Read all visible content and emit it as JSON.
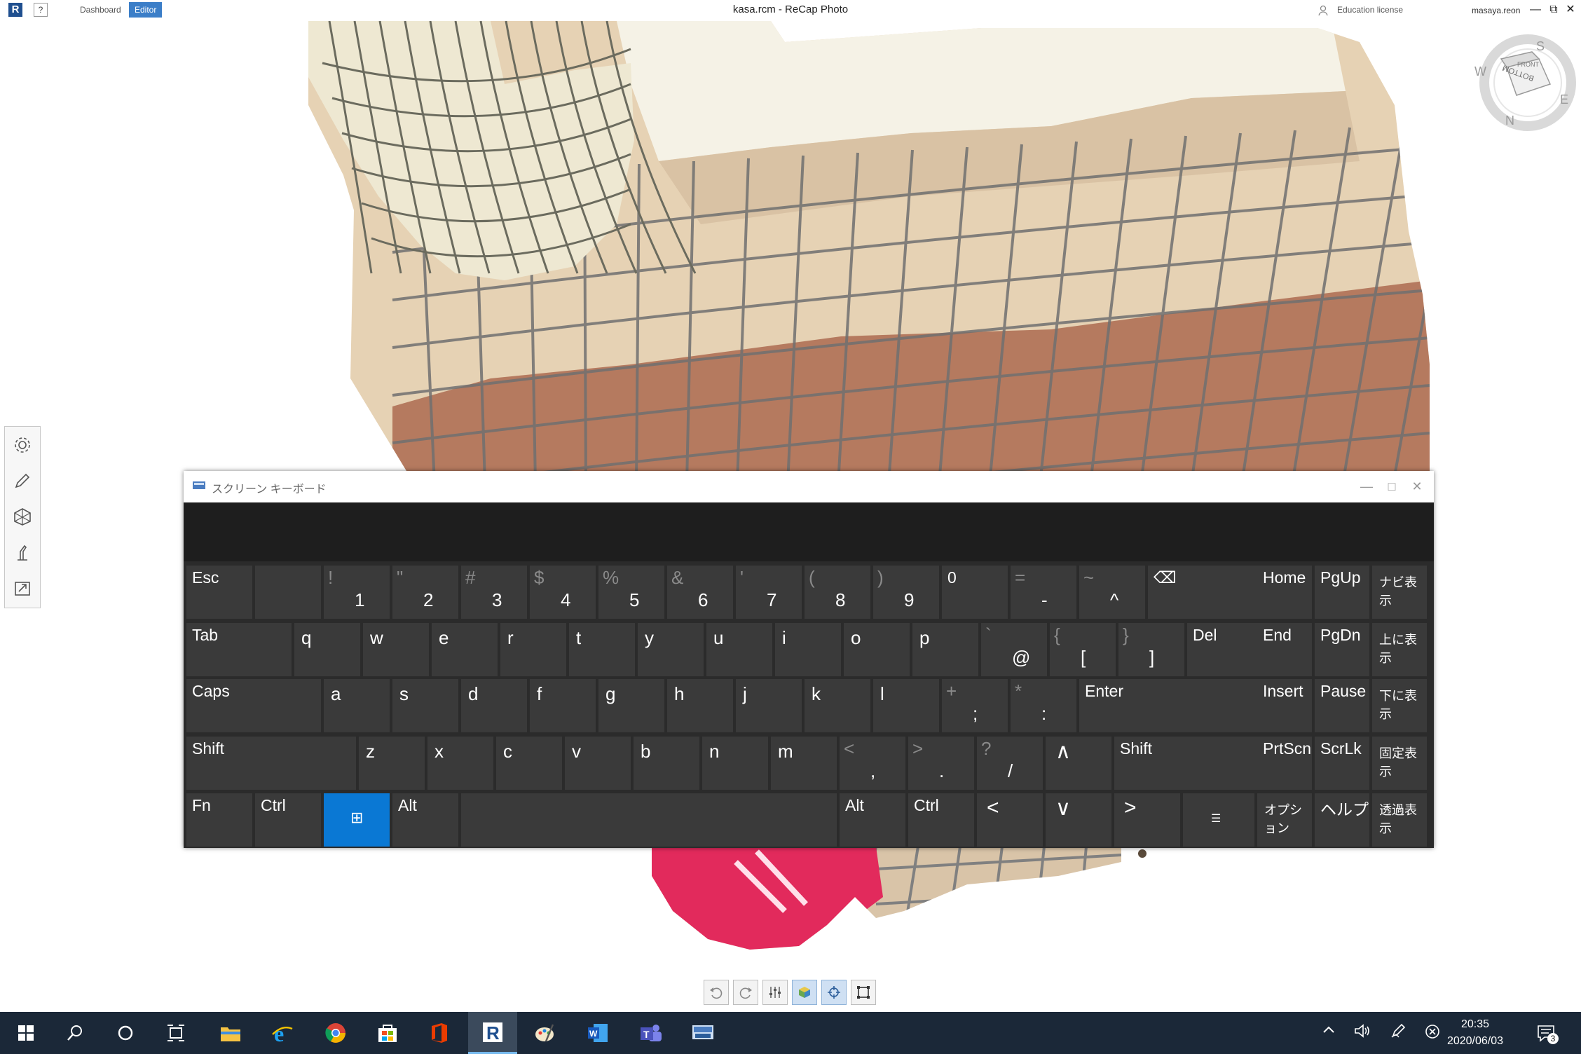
{
  "app": {
    "title": "kasa.rcm - ReCap Photo",
    "logo": "R",
    "help": "?",
    "tabs": [
      {
        "label": "Dashboard",
        "active": false
      },
      {
        "label": "Editor",
        "active": true
      }
    ],
    "license": "Education license",
    "user": "masaya.reon",
    "window_controls": {
      "minimize": "—",
      "restore": "⧉",
      "close": "✕"
    },
    "viewcube_labels": [
      "S",
      "W",
      "E",
      "N",
      "FRONT",
      "BOTTOM"
    ]
  },
  "left_tools": [
    {
      "name": "settings",
      "icon": "gear-icon"
    },
    {
      "name": "edit",
      "icon": "pencil-icon"
    },
    {
      "name": "mesh",
      "icon": "mesh-icon"
    },
    {
      "name": "measure",
      "icon": "measure-icon"
    },
    {
      "name": "export",
      "icon": "export-icon"
    }
  ],
  "keyboard": {
    "title": "スクリーン キーボード",
    "window_buttons": {
      "minimize": "—",
      "maximize": "□",
      "close": "✕"
    },
    "rows": [
      [
        {
          "l": "Esc",
          "t": "lab",
          "w": 94
        },
        {
          "l": "",
          "t": "lab",
          "w": 94
        },
        {
          "s": "!",
          "m": "1",
          "t": "char",
          "w": 94
        },
        {
          "s": "\"",
          "m": "2",
          "t": "char",
          "w": 94
        },
        {
          "s": "#",
          "m": "3",
          "t": "char",
          "w": 94
        },
        {
          "s": "$",
          "m": "4",
          "t": "char",
          "w": 94
        },
        {
          "s": "%",
          "m": "5",
          "t": "char",
          "w": 94
        },
        {
          "s": "&",
          "m": "6",
          "t": "char",
          "w": 94
        },
        {
          "s": "'",
          "m": "7",
          "t": "char",
          "w": 94
        },
        {
          "s": "(",
          "m": "8",
          "t": "char",
          "w": 94
        },
        {
          "s": ")",
          "m": "9",
          "t": "char",
          "w": 94
        },
        {
          "l": "0",
          "t": "lab",
          "w": 94
        },
        {
          "s": "=",
          "m": "-",
          "t": "char",
          "w": 94
        },
        {
          "s": "~",
          "m": "^",
          "t": "char",
          "w": 94
        },
        {
          "l": "⌫",
          "t": "lab",
          "w": 158
        }
      ],
      [
        {
          "l": "Tab",
          "t": "lab",
          "w": 150
        },
        {
          "l": "q",
          "t": "letter",
          "w": 94
        },
        {
          "l": "w",
          "t": "letter",
          "w": 94
        },
        {
          "l": "e",
          "t": "letter",
          "w": 94
        },
        {
          "l": "r",
          "t": "letter",
          "w": 94
        },
        {
          "l": "t",
          "t": "letter",
          "w": 94
        },
        {
          "l": "y",
          "t": "letter",
          "w": 94
        },
        {
          "l": "u",
          "t": "letter",
          "w": 94
        },
        {
          "l": "i",
          "t": "letter",
          "w": 94
        },
        {
          "l": "o",
          "t": "letter",
          "w": 94
        },
        {
          "l": "p",
          "t": "letter",
          "w": 94
        },
        {
          "s": "`",
          "m": "@",
          "t": "char",
          "w": 94
        },
        {
          "s": "{",
          "m": "[",
          "t": "char",
          "w": 94
        },
        {
          "s": "}",
          "m": "]",
          "t": "char",
          "w": 94
        },
        {
          "l": "Del",
          "t": "lab",
          "w": 102
        }
      ],
      [
        {
          "l": "Caps",
          "t": "lab",
          "w": 192
        },
        {
          "l": "a",
          "t": "letter",
          "w": 94
        },
        {
          "l": "s",
          "t": "letter",
          "w": 94
        },
        {
          "l": "d",
          "t": "letter",
          "w": 94
        },
        {
          "l": "f",
          "t": "letter",
          "w": 94
        },
        {
          "l": "g",
          "t": "letter",
          "w": 94
        },
        {
          "l": "h",
          "t": "letter",
          "w": 94
        },
        {
          "l": "j",
          "t": "letter",
          "w": 94
        },
        {
          "l": "k",
          "t": "letter",
          "w": 94
        },
        {
          "l": "l",
          "t": "letter",
          "w": 94
        },
        {
          "s": "+",
          "m": ";",
          "t": "char",
          "w": 94
        },
        {
          "s": "*",
          "m": ":",
          "t": "char",
          "w": 94
        },
        {
          "l": "Enter",
          "t": "lab",
          "w": 254
        }
      ],
      [
        {
          "l": "Shift",
          "t": "lab",
          "w": 242
        },
        {
          "l": "z",
          "t": "letter",
          "w": 94
        },
        {
          "l": "x",
          "t": "letter",
          "w": 94
        },
        {
          "l": "c",
          "t": "letter",
          "w": 94
        },
        {
          "l": "v",
          "t": "letter",
          "w": 94
        },
        {
          "l": "b",
          "t": "letter",
          "w": 94
        },
        {
          "l": "n",
          "t": "letter",
          "w": 94
        },
        {
          "l": "m",
          "t": "letter",
          "w": 94
        },
        {
          "s": "<",
          "m": ",",
          "t": "char",
          "w": 94
        },
        {
          "s": ">",
          "m": ".",
          "t": "char",
          "w": 94
        },
        {
          "s": "?",
          "m": "/",
          "t": "char",
          "w": 94
        },
        {
          "l": "∧",
          "t": "arrow",
          "w": 94
        },
        {
          "l": "Shift",
          "t": "lab",
          "w": 204
        }
      ],
      [
        {
          "l": "Fn",
          "t": "lab",
          "w": 94
        },
        {
          "l": "Ctrl",
          "t": "lab",
          "w": 94
        },
        {
          "l": "⊞",
          "t": "win",
          "w": 94
        },
        {
          "l": "Alt",
          "t": "lab",
          "w": 94
        },
        {
          "l": "",
          "t": "lab",
          "w": 536
        },
        {
          "l": "Alt",
          "t": "lab",
          "w": 94
        },
        {
          "l": "Ctrl",
          "t": "lab",
          "w": 94
        },
        {
          "l": "<",
          "t": "arrow",
          "w": 94
        },
        {
          "l": "∨",
          "t": "arrow",
          "w": 94
        },
        {
          "l": ">",
          "t": "arrow",
          "w": 94
        },
        {
          "l": "☰",
          "t": "small",
          "w": 102
        }
      ]
    ],
    "nav_keys": [
      [
        {
          "l": "Home"
        },
        {
          "l": "PgUp"
        },
        {
          "l": "ナビ表示",
          "jp": true
        }
      ],
      [
        {
          "l": "End"
        },
        {
          "l": "PgDn"
        },
        {
          "l": "上に表示",
          "jp": true
        }
      ],
      [
        {
          "l": "Insert"
        },
        {
          "l": "Pause"
        },
        {
          "l": "下に表示",
          "jp": true
        }
      ],
      [
        {
          "l": "PrtScn"
        },
        {
          "l": "ScrLk"
        },
        {
          "l": "固定表示",
          "jp": true
        }
      ],
      [
        {
          "l": "オプション",
          "jp": true
        },
        {
          "l": "ヘルプ"
        },
        {
          "l": "透過表示",
          "jp": true
        }
      ]
    ]
  },
  "view_toolbar": [
    {
      "name": "undo",
      "icon": "undo-icon"
    },
    {
      "name": "redo",
      "icon": "redo-icon"
    },
    {
      "name": "adjust",
      "icon": "sliders-icon"
    },
    {
      "name": "render-mode",
      "icon": "cube-icon"
    },
    {
      "name": "target",
      "icon": "target-icon"
    },
    {
      "name": "crop",
      "icon": "crop-icon"
    }
  ],
  "taskbar": {
    "apps": [
      {
        "name": "start",
        "icon": "windows-icon"
      },
      {
        "name": "search",
        "icon": "search-icon"
      },
      {
        "name": "cortana",
        "icon": "circle-icon"
      },
      {
        "name": "task-view",
        "icon": "task-view-icon"
      },
      {
        "name": "file-explorer",
        "icon": "folder-icon"
      },
      {
        "name": "edge",
        "icon": "ie-icon"
      },
      {
        "name": "chrome",
        "icon": "chrome-icon"
      },
      {
        "name": "store",
        "icon": "store-icon"
      },
      {
        "name": "office",
        "icon": "office-icon"
      },
      {
        "name": "recap",
        "icon": "recap-icon",
        "active": true
      },
      {
        "name": "paint",
        "icon": "paint-icon"
      },
      {
        "name": "word",
        "icon": "word-icon"
      },
      {
        "name": "teams",
        "icon": "teams-icon"
      },
      {
        "name": "osk",
        "icon": "keyboard-icon"
      }
    ],
    "time": "20:35",
    "date": "2020/06/03",
    "notifications_badge": "3"
  },
  "colors": {
    "accent": "#0a78d4",
    "key_bg": "#3a3a3a",
    "keyboard_bg": "#2b2b2b",
    "taskbar_bg": "#1b2838",
    "tile_cream": "#e9d3b4",
    "tile_brick": "#b5775e",
    "grout": "#6f6f6f",
    "wall": "#f4f1e4",
    "cloth": "#e0245a"
  }
}
